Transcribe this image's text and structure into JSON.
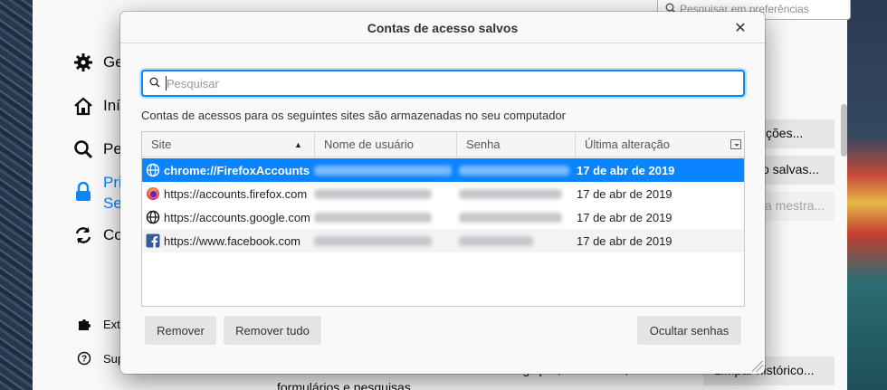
{
  "background_window": {
    "search_placeholder": "Pesquisar em preferências",
    "nav": [
      {
        "label": "Ge",
        "icon": "gear-icon"
      },
      {
        "label": "Iní",
        "icon": "home-icon"
      },
      {
        "label": "Pe",
        "icon": "search-icon"
      },
      {
        "label": "Pri",
        "label2": "Se",
        "icon": "lock-icon"
      },
      {
        "label": "Co",
        "icon": "sync-icon"
      }
    ],
    "nav_bottom": [
      {
        "label": "Ext",
        "icon": "puzzle-icon"
      },
      {
        "label": "Sup",
        "icon": "help-icon"
      }
    ],
    "buttons": [
      "ções...",
      "o salvas...",
      "a mestra...",
      "Limpar histórico..."
    ],
    "text_lines": [
      "O Firefox memorizará seu histórico de navegação, downloads,",
      "formulários e pesquisas."
    ]
  },
  "dialog": {
    "title": "Contas de acesso salvos",
    "close_label": "✕",
    "filter_placeholder": "Pesquisar",
    "intro": "Contas de acessos para os seguintes sites são armazenadas no seu computador",
    "columns": [
      "Site",
      "Nome de usuário",
      "Senha",
      "Última alteração"
    ],
    "rows": [
      {
        "site": "chrome://FirefoxAccounts",
        "date": "17 de abr de 2019",
        "icon": "globe-icon",
        "selected": true
      },
      {
        "site": "https://accounts.firefox.com",
        "date": "17 de abr de 2019",
        "icon": "firefox-icon",
        "selected": false
      },
      {
        "site": "https://accounts.google.com",
        "date": "17 de abr de 2019",
        "icon": "globe-icon",
        "selected": false
      },
      {
        "site": "https://www.facebook.com",
        "date": "17 de abr de 2019",
        "icon": "facebook-icon",
        "selected": false
      }
    ],
    "buttons": {
      "remove": "Remover",
      "remove_all": "Remover tudo",
      "hide_passwords": "Ocultar senhas"
    }
  },
  "colors": {
    "accent": "#0a84ff",
    "dialog_bg": "#f9f9fa"
  }
}
